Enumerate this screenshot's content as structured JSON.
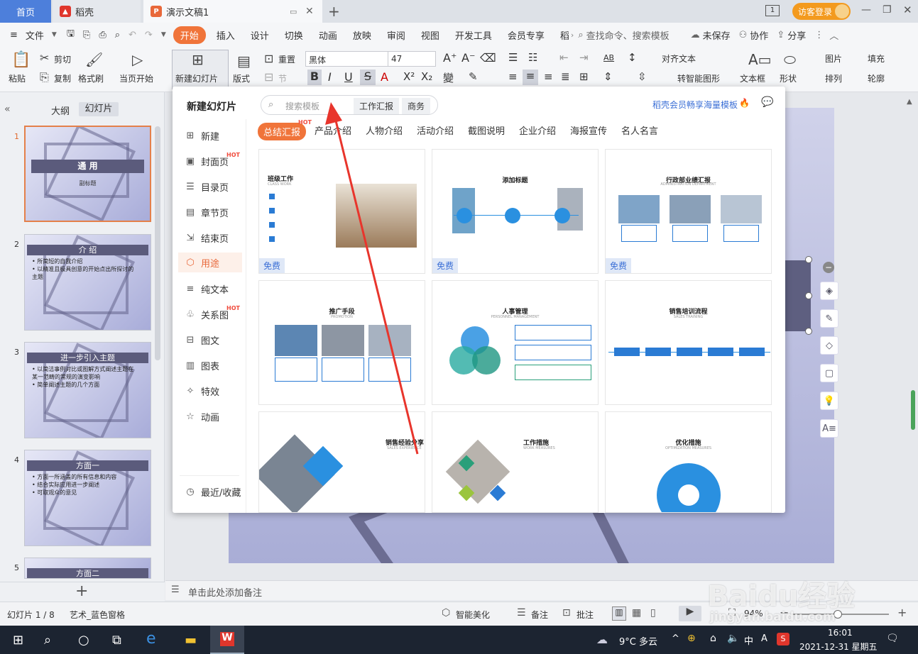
{
  "titlebar": {
    "tab_home": "首页",
    "tab_daoke": "稻壳",
    "tab_doc": "演示文稿1",
    "visitor": "访客登录",
    "page_indicator": "1"
  },
  "menubar": {
    "file": "文件",
    "items": [
      "开始",
      "插入",
      "设计",
      "切换",
      "动画",
      "放映",
      "审阅",
      "视图",
      "开发工具",
      "会员专享",
      "稻"
    ],
    "search": "查找命令、搜索模板",
    "unsaved": "未保存",
    "collab": "协作",
    "share": "分享"
  },
  "ribbon": {
    "paste": "粘贴",
    "cut": "剪切",
    "copy": "复制",
    "format_painter": "格式刷",
    "from_current": "当页开始",
    "new_slide": "新建幻灯片",
    "layout": "版式",
    "reset": "重置",
    "section": "节",
    "font_name": "黑体",
    "font_size": "47",
    "align_text": "对齐文本",
    "smart_shape": "转智能图形",
    "textbox": "文本框",
    "shape": "形状",
    "picture": "图片",
    "arrange": "排列",
    "fill": "填充",
    "outline": "轮廓",
    "ab_label": "AB"
  },
  "leftpanel": {
    "tab_outline": "大纲",
    "tab_slides": "幻灯片",
    "slides": [
      {
        "num": "1",
        "title": "通 用",
        "body": "副标题"
      },
      {
        "num": "2",
        "title": "介 绍",
        "body": "• 所简短的自我介绍\n• 以精准且极具创意的开始点出所探讨的主题"
      },
      {
        "num": "3",
        "title": "进一步引入主题",
        "body": "• 以简洁事例对比或图解方式阐述主题在某一范畴的常规的演变影响\n• 简单阐述主题的几个方面"
      },
      {
        "num": "4",
        "title": "方面一",
        "body": "• 方面一所涵盖的所有信息和内容\n• 结合实际应用进一步阐述\n• 可取观众的意见"
      },
      {
        "num": "5",
        "title": "方面二",
        "body": ""
      }
    ],
    "add": "+"
  },
  "dropdown": {
    "title": "新建幻灯片",
    "search_placeholder": "搜索模板",
    "tag1": "工作汇报",
    "tag2": "商务",
    "vip_link": "稻壳会员畅享海量模板",
    "nav": [
      "新建",
      "封面页",
      "目录页",
      "章节页",
      "结束页",
      "用途",
      "纯文本",
      "关系图",
      "图文",
      "图表",
      "特效",
      "动画"
    ],
    "recent": "最近/收藏",
    "hot": "HOT",
    "categories": [
      "总结汇报",
      "产品介绍",
      "人物介绍",
      "活动介绍",
      "截图说明",
      "企业介绍",
      "海报宣传",
      "名人名言"
    ],
    "free": "免费",
    "cards": [
      {
        "title": "班级工作",
        "sub": "CLASS WORK"
      },
      {
        "title": "添加标题",
        "sub": ""
      },
      {
        "title": "行政部业绩汇报",
        "sub": "ADMINISTRATION DEPARTMENT"
      },
      {
        "title": "推广手段",
        "sub": "PROMOTION"
      },
      {
        "title": "人事管理",
        "sub": "PERSONNEL MANAGEMENT"
      },
      {
        "title": "销售培训流程",
        "sub": "SALES TRAINING"
      },
      {
        "title": "销售经验分享",
        "sub": "SALES EXPERIENCE"
      },
      {
        "title": "工作措施",
        "sub": "WORK MEASURES"
      },
      {
        "title": "优化措施",
        "sub": "OPTIMIZATION MEASURES"
      }
    ]
  },
  "notes": {
    "placeholder": "单击此处添加备注"
  },
  "statusbar": {
    "slide_count": "幻灯片 1 / 8",
    "theme": "艺术_蓝色窗格",
    "beautify": "智能美化",
    "notes": "备注",
    "comments": "批注",
    "zoom": "94%"
  },
  "taskbar": {
    "weather": "9°C 多云",
    "time": "16:01",
    "date": "2021-12-31 星期五"
  },
  "watermark": {
    "text": "Baidu经验",
    "url": "jingyan.baidu.com"
  },
  "colors": {
    "accent": "#f0743a",
    "blue": "#4d7fdb",
    "hot": "#f04b3c",
    "slide_bg": "#a9add6",
    "arrow": "#e8352c"
  }
}
